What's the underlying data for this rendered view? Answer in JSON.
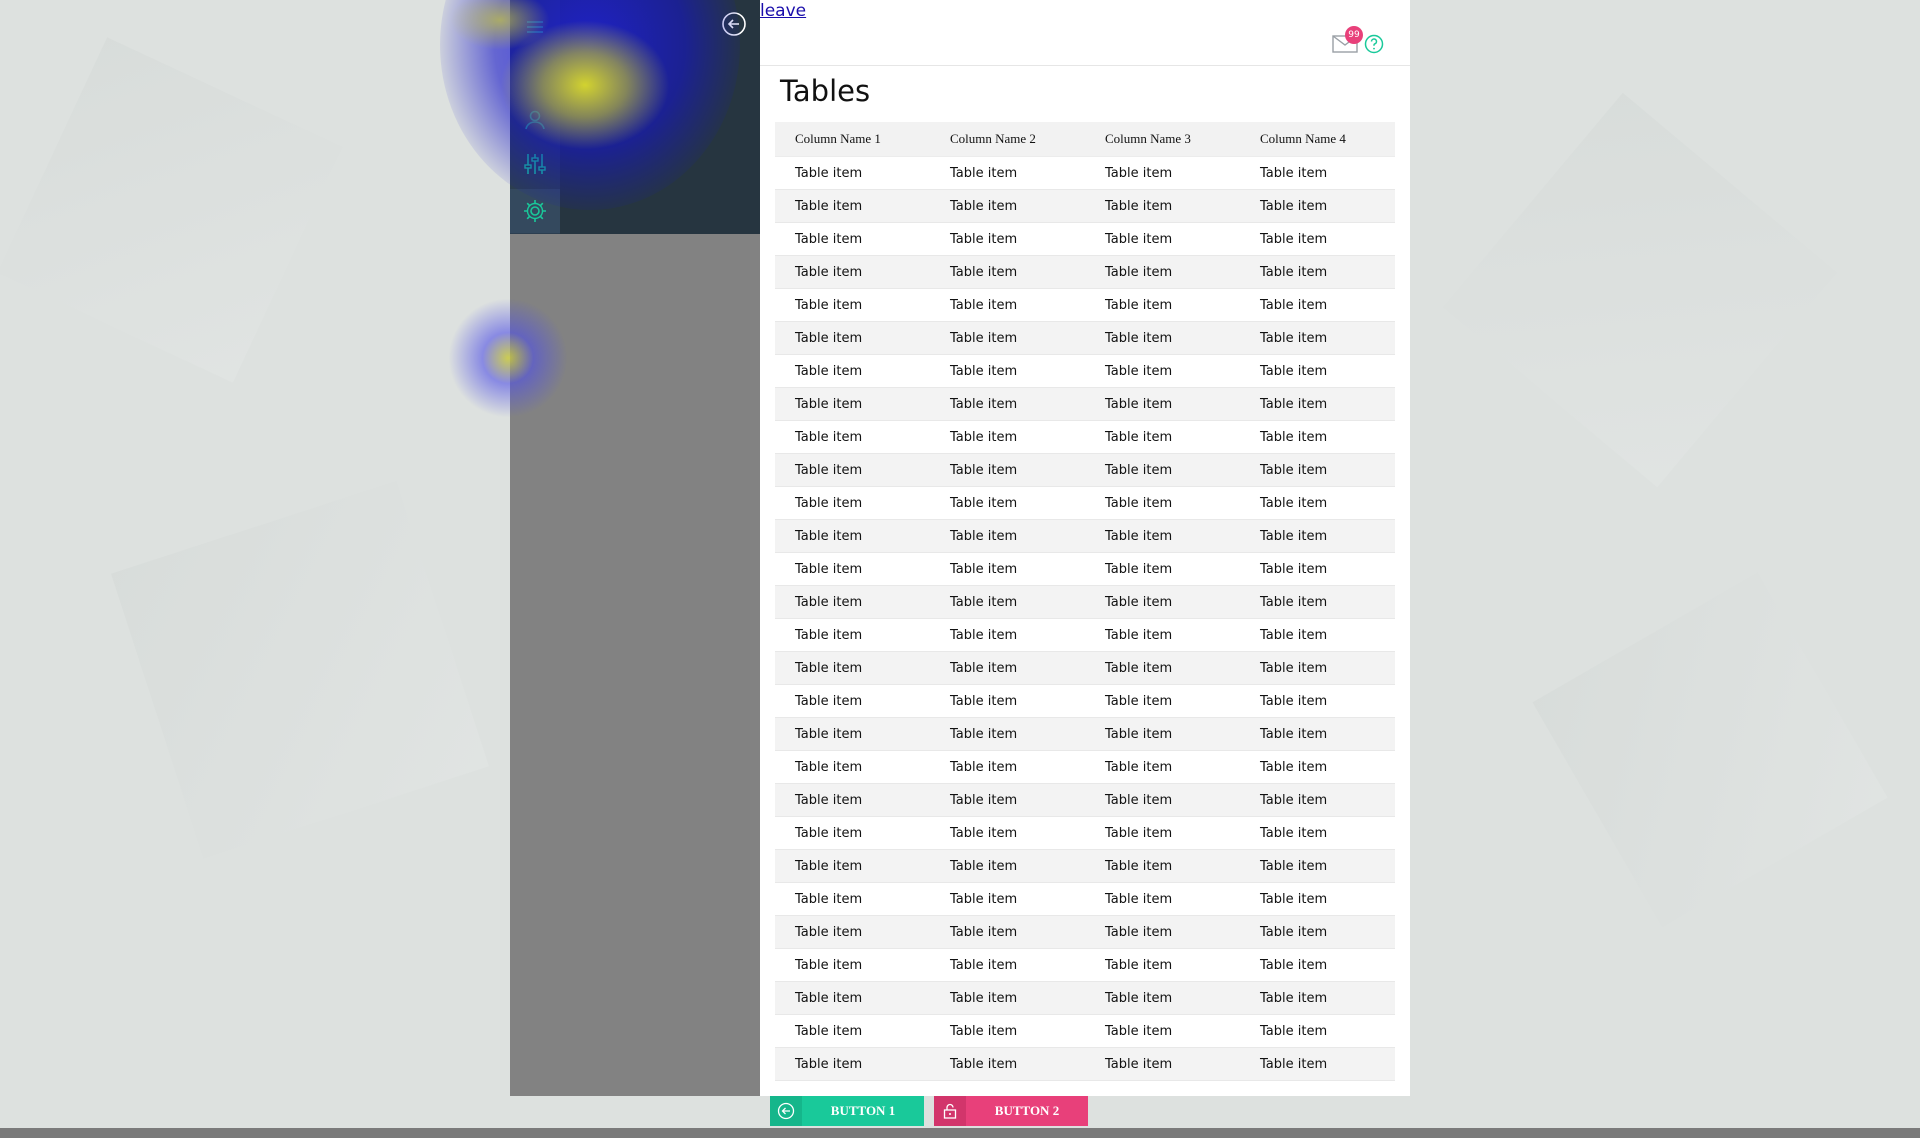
{
  "colors": {
    "accent_teal": "#19c99a",
    "accent_pink": "#e8407a",
    "sidebar_dark": "#263540",
    "sidebar_icon": "#19c99a"
  },
  "header": {
    "leave_link": "leave",
    "notifications_badge": "99",
    "mail_icon": "mail-icon",
    "help_icon": "help-icon"
  },
  "sidebar": {
    "collapse_icon": "arrow-left-circle-icon",
    "items": [
      {
        "icon": "user-icon"
      },
      {
        "icon": "sliders-icon"
      },
      {
        "icon": "gear-icon"
      }
    ]
  },
  "main": {
    "title": "Tables",
    "table": {
      "columns": [
        "Column Name 1",
        "Column Name 2",
        "Column Name 3",
        "Column Name 4"
      ],
      "rows": [
        [
          "Table item",
          "Table item",
          "Table item",
          "Table item"
        ],
        [
          "Table item",
          "Table item",
          "Table item",
          "Table item"
        ],
        [
          "Table item",
          "Table item",
          "Table item",
          "Table item"
        ],
        [
          "Table item",
          "Table item",
          "Table item",
          "Table item"
        ],
        [
          "Table item",
          "Table item",
          "Table item",
          "Table item"
        ],
        [
          "Table item",
          "Table item",
          "Table item",
          "Table item"
        ],
        [
          "Table item",
          "Table item",
          "Table item",
          "Table item"
        ],
        [
          "Table item",
          "Table item",
          "Table item",
          "Table item"
        ],
        [
          "Table item",
          "Table item",
          "Table item",
          "Table item"
        ],
        [
          "Table item",
          "Table item",
          "Table item",
          "Table item"
        ],
        [
          "Table item",
          "Table item",
          "Table item",
          "Table item"
        ],
        [
          "Table item",
          "Table item",
          "Table item",
          "Table item"
        ],
        [
          "Table item",
          "Table item",
          "Table item",
          "Table item"
        ],
        [
          "Table item",
          "Table item",
          "Table item",
          "Table item"
        ],
        [
          "Table item",
          "Table item",
          "Table item",
          "Table item"
        ],
        [
          "Table item",
          "Table item",
          "Table item",
          "Table item"
        ],
        [
          "Table item",
          "Table item",
          "Table item",
          "Table item"
        ],
        [
          "Table item",
          "Table item",
          "Table item",
          "Table item"
        ],
        [
          "Table item",
          "Table item",
          "Table item",
          "Table item"
        ],
        [
          "Table item",
          "Table item",
          "Table item",
          "Table item"
        ],
        [
          "Table item",
          "Table item",
          "Table item",
          "Table item"
        ],
        [
          "Table item",
          "Table item",
          "Table item",
          "Table item"
        ],
        [
          "Table item",
          "Table item",
          "Table item",
          "Table item"
        ],
        [
          "Table item",
          "Table item",
          "Table item",
          "Table item"
        ],
        [
          "Table item",
          "Table item",
          "Table item",
          "Table item"
        ],
        [
          "Table item",
          "Table item",
          "Table item",
          "Table item"
        ],
        [
          "Table item",
          "Table item",
          "Table item",
          "Table item"
        ],
        [
          "Table item",
          "Table item",
          "Table item",
          "Table item"
        ]
      ]
    }
  },
  "footer": {
    "button1": {
      "label": "BUTTON 1",
      "icon": "arrow-left-circle-icon"
    },
    "button2": {
      "label": "BUTTON 2",
      "icon": "unlock-icon"
    }
  }
}
